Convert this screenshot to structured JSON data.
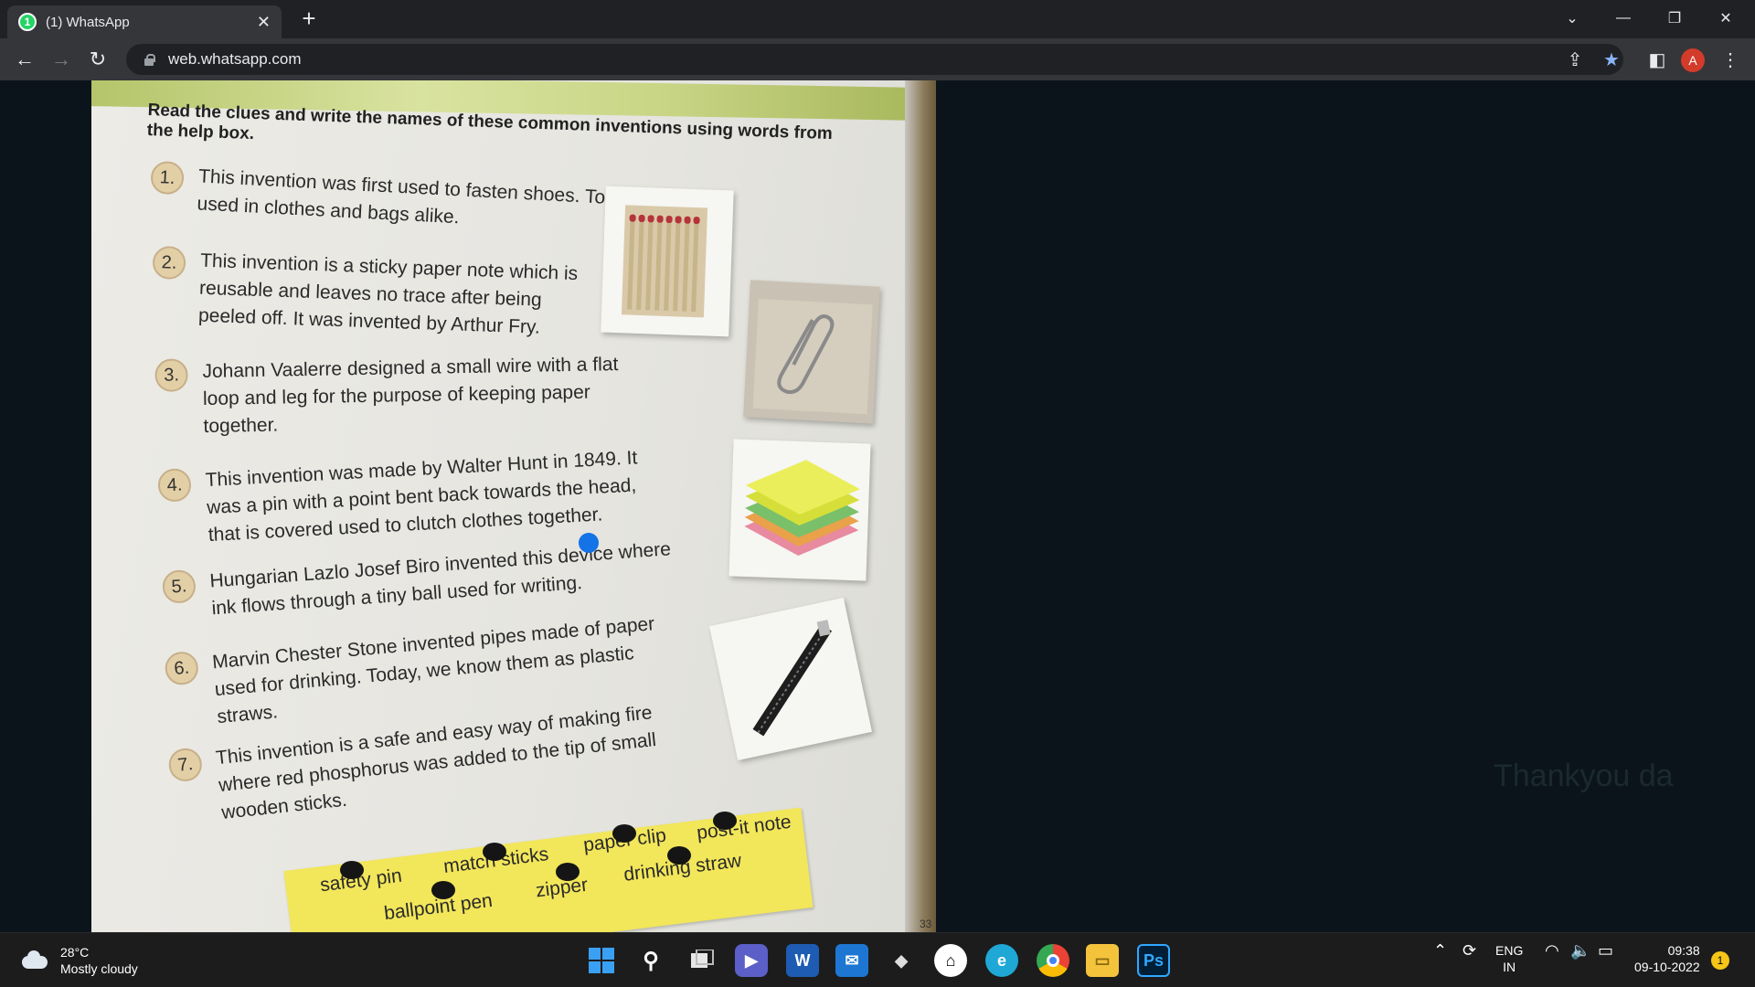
{
  "browser": {
    "tab_title": "(1) WhatsApp",
    "tab_badge": "1",
    "url": "web.whatsapp.com",
    "profile_initial": "A"
  },
  "worksheet": {
    "heading": "Read the clues and write the names of these common inventions using words from the help box.",
    "clues": [
      {
        "num": "1.",
        "text": "This invention was first used to fasten shoes. Today it is used in clothes and bags alike."
      },
      {
        "num": "2.",
        "text": "This invention is a sticky paper note which is reusable and leaves no trace after being peeled off. It was invented by Arthur Fry."
      },
      {
        "num": "3.",
        "text": "Johann Vaalerre designed a small wire with a flat loop and leg for the purpose of keeping paper together."
      },
      {
        "num": "4.",
        "text": "This invention was made by Walter Hunt in 1849. It was a pin with a point bent back towards the head, that is covered used to clutch clothes together."
      },
      {
        "num": "5.",
        "text": "Hungarian Lazlo Josef Biro invented this device where ink flows through a tiny ball used for writing."
      },
      {
        "num": "6.",
        "text": "Marvin Chester Stone invented pipes made of paper used for drinking. Today, we know them as plastic straws."
      },
      {
        "num": "7.",
        "text": "This invention is a safe and easy way of making fire where red phosphorus was added to the tip of small wooden sticks."
      }
    ],
    "help_words": [
      "safety pin",
      "match sticks",
      "paper clip",
      "post-it note",
      "ballpoint pen",
      "zipper",
      "drinking straw"
    ],
    "page_number": "33"
  },
  "background_text": "Thankyou da",
  "taskbar": {
    "temperature": "28°C",
    "weather": "Mostly cloudy",
    "language": "ENG",
    "region": "IN",
    "time": "09:38",
    "date": "09-10-2022",
    "notification_count": "1"
  }
}
